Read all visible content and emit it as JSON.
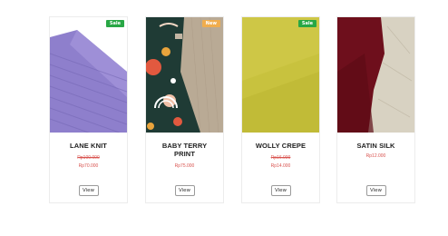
{
  "products": [
    {
      "name": "LANE KNIT",
      "badge": "Sale",
      "badge_color": "#28a745",
      "old_price": "Rp100.000",
      "price": "Rp70.000",
      "button": "View"
    },
    {
      "name": "BABY TERRY PRINT",
      "badge": "New",
      "badge_color": "#f0ad4e",
      "price": "Rp75.000",
      "button": "View"
    },
    {
      "name": "WOLLY CREPE",
      "badge": "Sale",
      "badge_color": "#28a745",
      "old_price": "Rp16.000",
      "price": "Rp14.000",
      "button": "View"
    },
    {
      "name": "SATIN SILK",
      "price": "Rp12.000",
      "button": "View"
    }
  ]
}
